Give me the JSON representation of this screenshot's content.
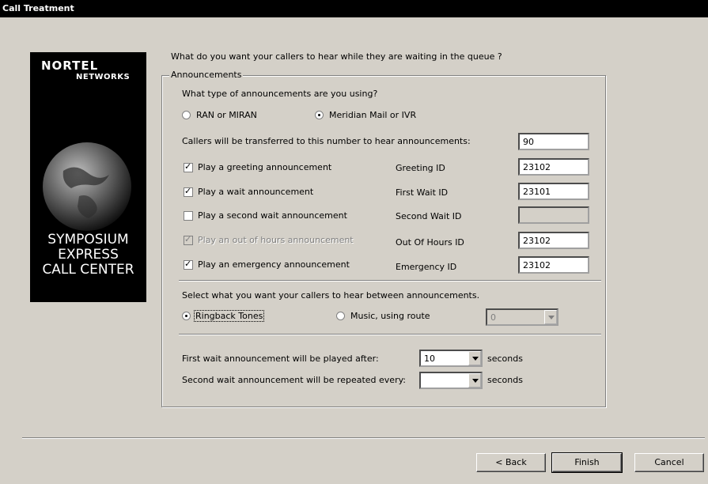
{
  "window": {
    "title": "Call Treatment"
  },
  "brand": {
    "logo_line1": "NORTEL",
    "logo_line2": "NETWORKS",
    "product_line1": "SYMPOSIUM",
    "product_line2": "EXPRESS",
    "product_line3": "CALL CENTER"
  },
  "question": "What do you want your callers to hear while they are waiting in the queue ?",
  "announcements": {
    "legend": "Announcements",
    "type_question": "What type of announcements are you using?",
    "options": [
      {
        "label": "RAN or MIRAN",
        "selected": false
      },
      {
        "label": "Meridian Mail or IVR",
        "selected": true
      }
    ],
    "transfer_label": "Callers will be transferred to this number to hear announcements:",
    "transfer_value": "90",
    "rows": [
      {
        "label": "Play a greeting announcement",
        "checked": true,
        "enabled": true,
        "id_label": "Greeting ID",
        "id_value": "23102",
        "id_enabled": true
      },
      {
        "label": "Play a wait announcement",
        "checked": true,
        "enabled": true,
        "id_label": "First Wait ID",
        "id_value": "23101",
        "id_enabled": true
      },
      {
        "label": "Play a second wait announcement",
        "checked": false,
        "enabled": true,
        "id_label": "Second Wait ID",
        "id_value": "",
        "id_enabled": false
      },
      {
        "label": "Play an out of hours announcement",
        "checked": true,
        "enabled": false,
        "id_label": "Out Of Hours ID",
        "id_value": "23102",
        "id_enabled": true
      },
      {
        "label": "Play an emergency announcement",
        "checked": true,
        "enabled": true,
        "id_label": "Emergency ID",
        "id_value": "23102",
        "id_enabled": true
      }
    ]
  },
  "between": {
    "prompt": "Select what you want your callers to hear between announcements.",
    "ringback_label": "Ringback Tones",
    "ringback_selected": true,
    "music_label": "Music, using route",
    "music_selected": false,
    "route_value": "0"
  },
  "timing": {
    "first_label": "First wait announcement will be played after:",
    "first_value": "10",
    "second_label": "Second wait announcement will be repeated every:",
    "second_value": "",
    "unit": "seconds"
  },
  "buttons": {
    "back": "< Back",
    "finish": "Finish",
    "cancel": "Cancel"
  }
}
